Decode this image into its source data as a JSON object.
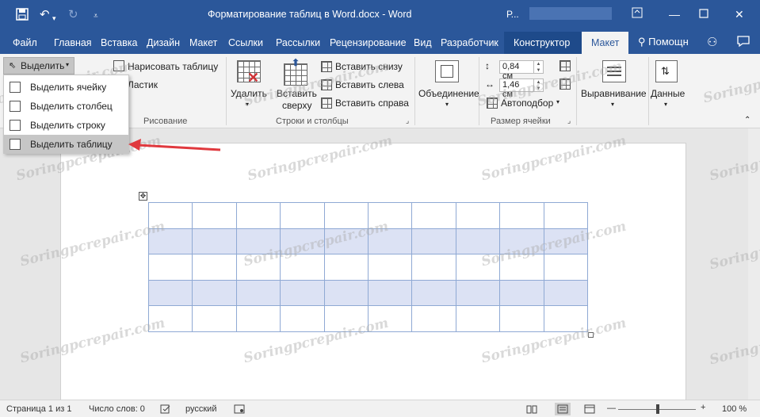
{
  "titlebar": {
    "save_icon": "save-icon",
    "undo_icon": "undo-icon",
    "redo_icon": "redo-icon",
    "customize_icon": "customize-quick-access-icon",
    "title": "Форматирование таблиц в Word.docx - Word",
    "account_initial": "Р...",
    "restore_icon": "ribbon-display-icon",
    "minimize_icon": "minimize-icon",
    "maximize_icon": "maximize-icon",
    "close_icon": "close-icon"
  },
  "tabs": {
    "items": [
      {
        "label": "Файл"
      },
      {
        "label": "Главная"
      },
      {
        "label": "Вставка"
      },
      {
        "label": "Дизайн"
      },
      {
        "label": "Макет"
      },
      {
        "label": "Ссылки"
      },
      {
        "label": "Рассылки"
      },
      {
        "label": "Рецензирование"
      },
      {
        "label": "Вид"
      },
      {
        "label": "Разработчик"
      },
      {
        "label": "Конструктор"
      },
      {
        "label": "Макет"
      }
    ],
    "help_label": "Помощн"
  },
  "ribbon": {
    "select_label": "Выделить",
    "draw_table_label": "Нарисовать таблицу",
    "eraser_label": "Ластик",
    "group_drawing": "Рисование",
    "delete_label": "Удалить",
    "insert_above_line1": "Вставить",
    "insert_above_line2": "сверху",
    "insert_below_label": "Вставить снизу",
    "insert_left_label": "Вставить слева",
    "insert_right_label": "Вставить справа",
    "group_rows_cols": "Строки и столбцы",
    "merge_label": "Объединение",
    "height_value": "0,84 см",
    "width_value": "1,46 см",
    "autofit_label": "Автоподбор",
    "group_cell_size": "Размер ячейки",
    "alignment_label": "Выравнивание",
    "data_label": "Данные"
  },
  "select_menu": {
    "items": [
      {
        "label": "Выделить ячейку"
      },
      {
        "label": "Выделить столбец"
      },
      {
        "label": "Выделить строку"
      },
      {
        "label": "Выделить таблицу"
      }
    ]
  },
  "document": {
    "table_rows": 5,
    "table_cols": 10,
    "selected_rows": [
      1,
      3
    ]
  },
  "watermark_text": "Soringpcrepair.com",
  "statusbar": {
    "page": "Страница 1 из 1",
    "words": "Число слов: 0",
    "language": "русский",
    "zoom": "100 %"
  },
  "colors": {
    "brand": "#2b579a",
    "selection": "#dce2f4",
    "table_border": "#8fa9d4",
    "arrow": "#e0393e"
  }
}
